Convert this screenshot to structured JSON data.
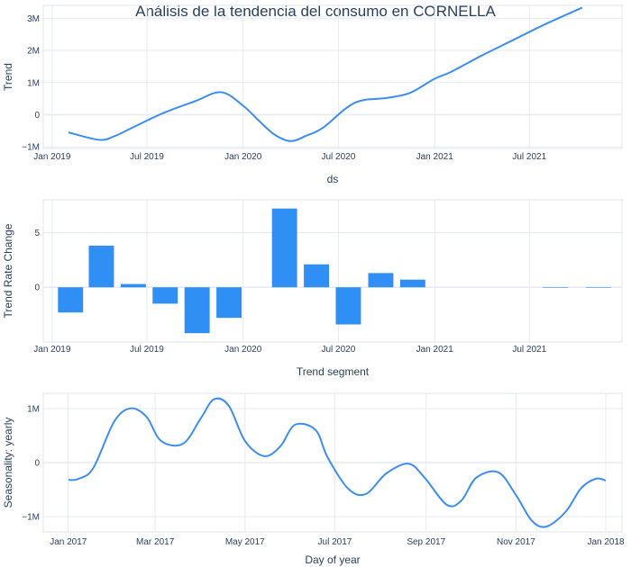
{
  "title": "Análisis de la tendencia del consumo en CORNELLA",
  "colors": {
    "line": "#3c8ef3",
    "bar": "#2f8ff5",
    "grid": "#e6eaf3",
    "frame": "#dfe4ee",
    "text": "#2a3f5f"
  },
  "chart_data": [
    {
      "type": "line",
      "name": "trend",
      "xlabel": "ds",
      "ylabel": "Trend",
      "x_is_date": true,
      "xlim": [
        "2018-12-15",
        "2021-12-25"
      ],
      "ylim": [
        -1.05,
        3.4
      ],
      "yunit": "M",
      "xticks": [
        {
          "date": "2019-01-01",
          "label": "Jan 2019"
        },
        {
          "date": "2019-07-01",
          "label": "Jul 2019"
        },
        {
          "date": "2020-01-01",
          "label": "Jan 2020"
        },
        {
          "date": "2020-07-01",
          "label": "Jul 2020"
        },
        {
          "date": "2021-01-01",
          "label": "Jan 2021"
        },
        {
          "date": "2021-07-01",
          "label": "Jul 2021"
        }
      ],
      "yticks": [
        {
          "value": 3,
          "label": "3M"
        },
        {
          "value": 2,
          "label": "2M"
        },
        {
          "value": 1,
          "label": "1M"
        },
        {
          "value": 0,
          "label": "0"
        },
        {
          "value": -1,
          "label": "−1M"
        }
      ],
      "x": [
        "2019-02-01",
        "2019-04-01",
        "2019-05-01",
        "2019-06-01",
        "2019-08-01",
        "2019-10-01",
        "2019-11-20",
        "2020-01-01",
        "2020-02-01",
        "2020-03-01",
        "2020-04-01",
        "2020-05-01",
        "2020-06-01",
        "2020-08-01",
        "2020-10-01",
        "2020-11-15",
        "2021-01-01",
        "2021-02-01",
        "2021-04-01",
        "2021-06-01",
        "2021-08-01",
        "2021-10-10"
      ],
      "y": [
        -0.55,
        -0.78,
        -0.66,
        -0.42,
        0.05,
        0.42,
        0.7,
        0.28,
        -0.2,
        -0.62,
        -0.82,
        -0.65,
        -0.41,
        0.37,
        0.52,
        0.68,
        1.12,
        1.33,
        1.84,
        2.33,
        2.82,
        3.33
      ]
    },
    {
      "type": "bar",
      "name": "trend-rate-change",
      "xlabel": "Trend segment",
      "ylabel": "Trend Rate Change",
      "x_is_date": true,
      "xlim": [
        "2018-12-15",
        "2021-12-25"
      ],
      "ylim": [
        -5,
        8
      ],
      "xticks": [
        {
          "date": "2019-01-01",
          "label": "Jan 2019"
        },
        {
          "date": "2019-07-01",
          "label": "Jul 2019"
        },
        {
          "date": "2020-01-01",
          "label": "Jan 2020"
        },
        {
          "date": "2020-07-01",
          "label": "Jul 2020"
        },
        {
          "date": "2021-01-01",
          "label": "Jan 2021"
        },
        {
          "date": "2021-07-01",
          "label": "Jul 2021"
        }
      ],
      "yticks": [
        {
          "value": 5,
          "label": "5"
        },
        {
          "value": 0,
          "label": "0"
        }
      ],
      "bar_width_days": 48,
      "x": [
        "2019-02-05",
        "2019-04-05",
        "2019-06-05",
        "2019-08-05",
        "2019-10-05",
        "2019-12-05",
        "2020-03-20",
        "2020-05-20",
        "2020-07-20",
        "2020-09-20",
        "2020-11-20",
        "2021-08-20",
        "2021-11-10"
      ],
      "y": [
        -2.3,
        3.8,
        0.3,
        -1.5,
        -4.2,
        -2.8,
        7.2,
        2.1,
        -3.4,
        1.3,
        0.7,
        0.02,
        0.02
      ]
    },
    {
      "type": "line",
      "name": "seasonality-yearly",
      "xlabel": "Day of year",
      "ylabel": "Seasonality: yearly",
      "x_is_date": true,
      "xlim": [
        "2016-12-15",
        "2018-01-12"
      ],
      "ylim": [
        -1.28,
        1.28
      ],
      "yunit": "M",
      "xticks": [
        {
          "date": "2017-01-01",
          "label": "Jan 2017"
        },
        {
          "date": "2017-03-01",
          "label": "Mar 2017"
        },
        {
          "date": "2017-05-01",
          "label": "May 2017"
        },
        {
          "date": "2017-07-01",
          "label": "Jul 2017"
        },
        {
          "date": "2017-09-01",
          "label": "Sep 2017"
        },
        {
          "date": "2017-11-01",
          "label": "Nov 2017"
        },
        {
          "date": "2018-01-01",
          "label": "Jan 2018"
        }
      ],
      "yticks": [
        {
          "value": 1,
          "label": "1M"
        },
        {
          "value": 0,
          "label": "0"
        },
        {
          "value": -1,
          "label": "−1M"
        }
      ],
      "x": [
        "2017-01-01",
        "2017-01-08",
        "2017-01-18",
        "2017-02-01",
        "2017-02-12",
        "2017-02-23",
        "2017-03-05",
        "2017-03-20",
        "2017-04-01",
        "2017-04-10",
        "2017-04-20",
        "2017-05-01",
        "2017-05-14",
        "2017-05-25",
        "2017-06-04",
        "2017-06-18",
        "2017-06-26",
        "2017-07-10",
        "2017-07-22",
        "2017-08-05",
        "2017-08-20",
        "2017-08-31",
        "2017-09-15",
        "2017-09-25",
        "2017-10-05",
        "2017-10-20",
        "2017-11-01",
        "2017-11-12",
        "2017-11-22",
        "2017-12-05",
        "2017-12-15",
        "2017-12-25",
        "2018-01-01"
      ],
      "y": [
        -0.32,
        -0.3,
        -0.1,
        0.75,
        1.0,
        0.85,
        0.4,
        0.35,
        0.82,
        1.17,
        1.05,
        0.4,
        0.12,
        0.3,
        0.7,
        0.6,
        0.1,
        -0.48,
        -0.58,
        -0.2,
        -0.02,
        -0.28,
        -0.78,
        -0.7,
        -0.28,
        -0.18,
        -0.6,
        -1.08,
        -1.18,
        -0.9,
        -0.48,
        -0.3,
        -0.33
      ]
    }
  ]
}
